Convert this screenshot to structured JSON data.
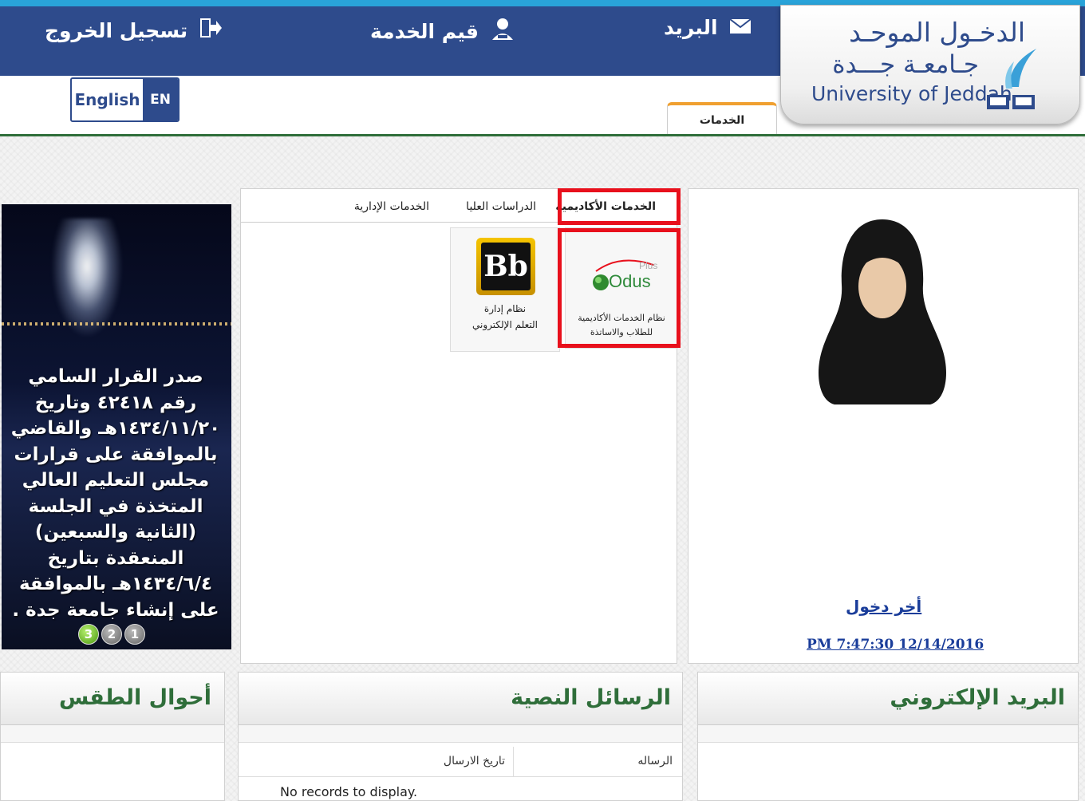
{
  "header": {
    "logout_label": "تسجيل الخروج",
    "rate_service_label": "قيم الخدمة",
    "mail_label": "البريد",
    "icons": [
      "logout-icon",
      "user-rate-icon",
      "envelope-icon"
    ]
  },
  "logo": {
    "title_ar": "الدخـول الموحـد",
    "university_ar": "جـامعـة جـــدة",
    "university_en": "University of Jeddah"
  },
  "language": {
    "full": "English",
    "short": "EN"
  },
  "main_tab": {
    "label": "الخدمات"
  },
  "profile": {
    "last_login_label": "أخر دخول",
    "last_login_value": "PM 7:47:30 12/14/2016"
  },
  "services": {
    "tabs": [
      "الخدمات الأكاديمية",
      "الدراسات العليا",
      "الخدمات الإدارية"
    ],
    "selected_tab": 0,
    "apps": [
      {
        "name": "odus",
        "logo_text": "Odus",
        "logo_sup": "Plus",
        "line1": "نظام الخدمات الأكاديمية",
        "line2": "للطلاب والاساتذة"
      },
      {
        "name": "blackboard",
        "logo_text": "Bb",
        "line1": "نظام إدارة",
        "line2": "التعلم الإلكتروني"
      }
    ]
  },
  "slider": {
    "caption": "صدر القرار السامي رقم ٤٢٤١٨ وتاريخ ١٤٣٤/١١/٢٠هـ والقاضي بالموافقة على قرارات مجلس التعليم العالي المتخذة في الجلسة (الثانية والسبعين) المنعقدة بتاريخ ١٤٣٤/٦/٤هـ بالموافقة على إنشاء جامعة جدة .",
    "dots": [
      "3",
      "2",
      "1"
    ],
    "active_dot": "3"
  },
  "widgets": {
    "email_title": "البريد الإلكتروني",
    "sms_title": "الرسائل النصية",
    "weather_title": "أحوال الطقس",
    "sms_columns": [
      "الرساله",
      "تاريخ الارسال"
    ],
    "no_records": "No records to display."
  },
  "colors": {
    "header_blue": "#2e4b8c",
    "accent_green": "#2f6e3a",
    "highlight_red": "#e8101c",
    "link_blue": "#1a3d9a"
  }
}
